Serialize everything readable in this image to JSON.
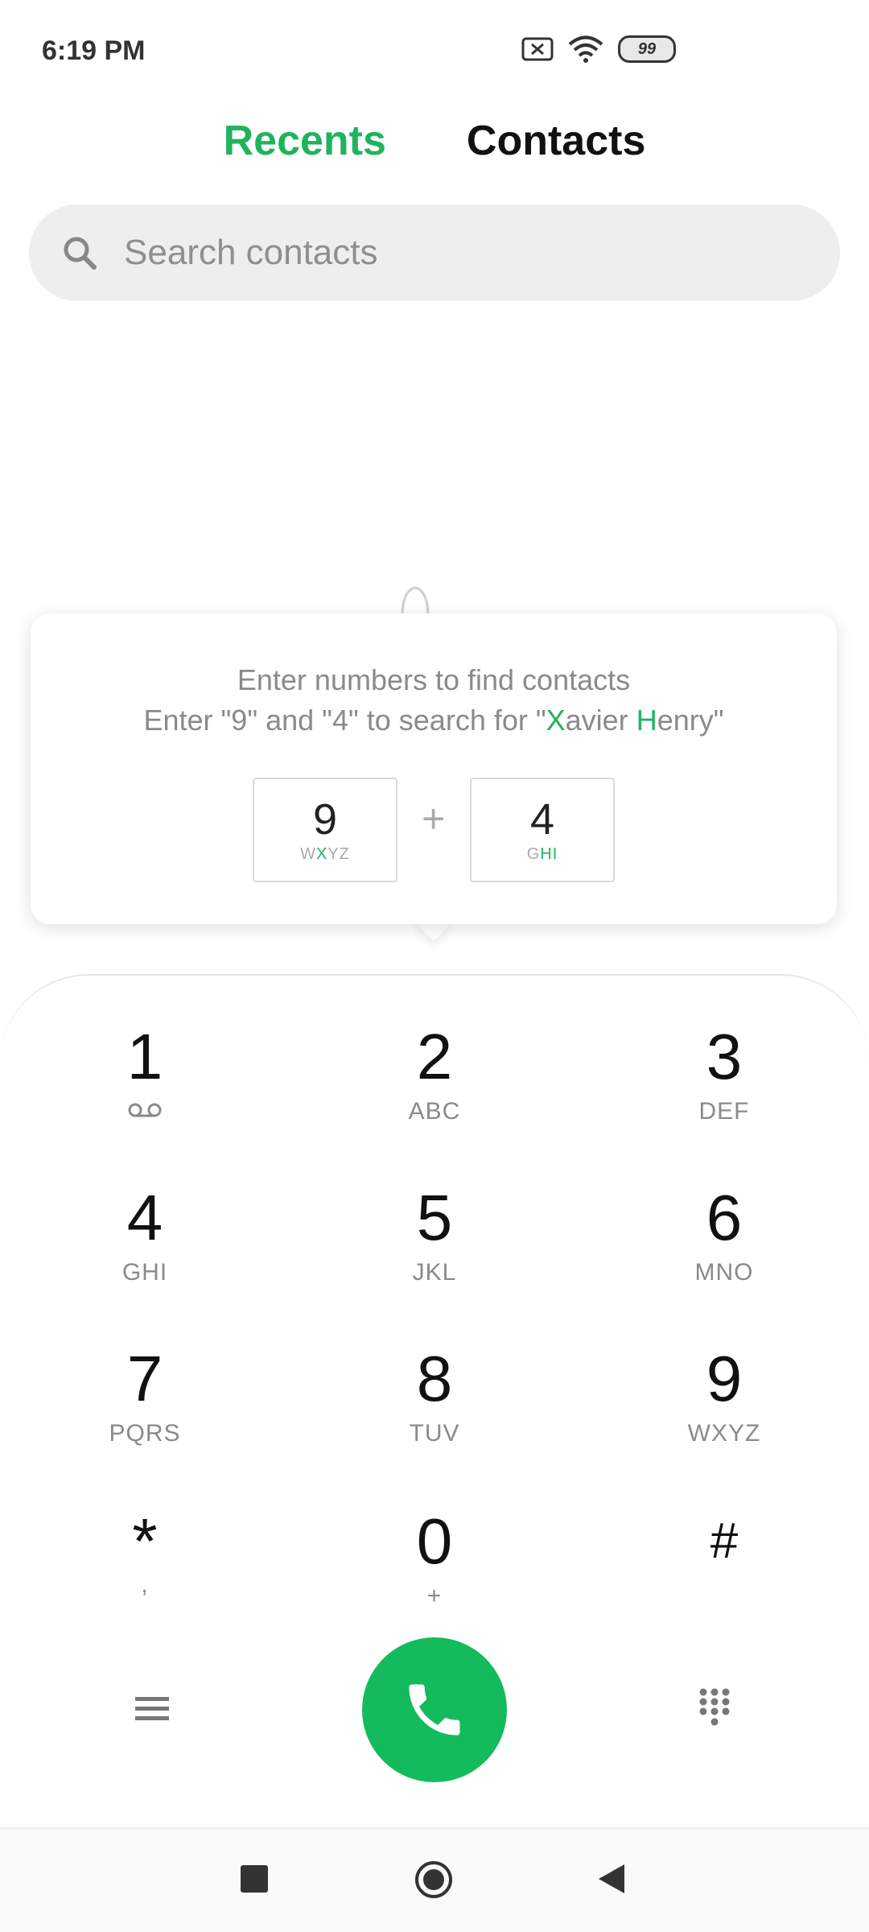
{
  "status_bar": {
    "time": "6:19 PM",
    "battery": "99"
  },
  "tabs": {
    "recents": "Recents",
    "contacts": "Contacts"
  },
  "search": {
    "placeholder": "Search contacts"
  },
  "hint": {
    "line1": "Enter numbers to find contacts",
    "line2_prefix": "Enter \"9\" and \"4\" to search for \"",
    "line2_h1": "X",
    "line2_mid": "avier ",
    "line2_h2": "H",
    "line2_suffix": "enry\"",
    "key1": {
      "digit": "9",
      "letters_pre": "W",
      "letters_hl": "X",
      "letters_post": "YZ"
    },
    "plus": "+",
    "key2": {
      "digit": "4",
      "letters_pre": "G",
      "letters_hl": "HI",
      "letters_post": ""
    }
  },
  "dialpad": {
    "k1": {
      "num": "1",
      "letters": ""
    },
    "k2": {
      "num": "2",
      "letters": "ABC"
    },
    "k3": {
      "num": "3",
      "letters": "DEF"
    },
    "k4": {
      "num": "4",
      "letters": "GHI"
    },
    "k5": {
      "num": "5",
      "letters": "JKL"
    },
    "k6": {
      "num": "6",
      "letters": "MNO"
    },
    "k7": {
      "num": "7",
      "letters": "PQRS"
    },
    "k8": {
      "num": "8",
      "letters": "TUV"
    },
    "k9": {
      "num": "9",
      "letters": "WXYZ"
    },
    "kstar": {
      "num": "*",
      "letters": ","
    },
    "k0": {
      "num": "0",
      "letters": "+"
    },
    "khash": {
      "num": "#",
      "letters": ""
    }
  },
  "colors": {
    "accent": "#20b35d",
    "call": "#13bb5c"
  },
  "icons": [
    "no-sim-icon",
    "wifi-icon",
    "battery-icon",
    "search-icon",
    "voicemail-icon",
    "menu-icon",
    "call-icon",
    "dialpad-icon",
    "recents-square-icon",
    "home-circle-icon",
    "back-triangle-icon"
  ]
}
